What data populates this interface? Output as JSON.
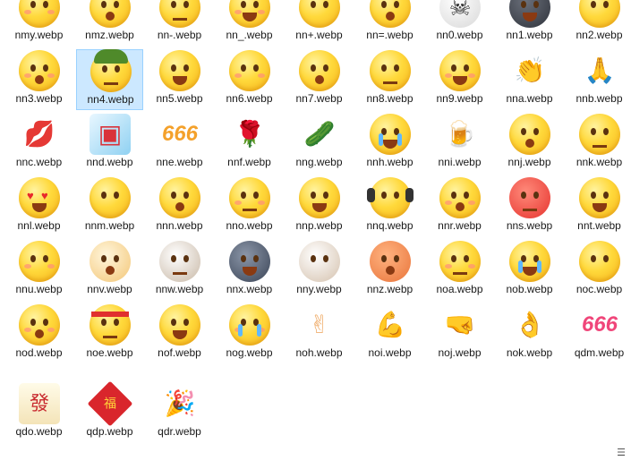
{
  "files": [
    {
      "name": "nmy.webp",
      "icon": "face-mask-emoji-icon"
    },
    {
      "name": "nmz.webp",
      "icon": "smirk-emoji-icon"
    },
    {
      "name": "nn-.webp",
      "icon": "surprised-emoji-icon"
    },
    {
      "name": "nn_.webp",
      "icon": "wink-tongue-emoji-icon"
    },
    {
      "name": "nn+.webp",
      "icon": "kiss-emoji-icon"
    },
    {
      "name": "nn=.webp",
      "icon": "grin-emoji-icon"
    },
    {
      "name": "nn0.webp",
      "icon": "skull-icon"
    },
    {
      "name": "nn1.webp",
      "icon": "dark-face-emoji-icon"
    },
    {
      "name": "nn2.webp",
      "icon": "watermelon-emoji-icon"
    },
    {
      "name": "nn3.webp",
      "icon": "big-grin-emoji-icon"
    },
    {
      "name": "nn4.webp",
      "icon": "green-hat-emoji-icon"
    },
    {
      "name": "nn5.webp",
      "icon": "sweat-emoji-icon"
    },
    {
      "name": "nn6.webp",
      "icon": "shy-emoji-icon"
    },
    {
      "name": "nn7.webp",
      "icon": "smile-emoji-icon"
    },
    {
      "name": "nn8.webp",
      "icon": "sweat-glance-emoji-icon"
    },
    {
      "name": "nn9.webp",
      "icon": "blush-emoji-icon"
    },
    {
      "name": "nna.webp",
      "icon": "clapping-hands-icon"
    },
    {
      "name": "nnb.webp",
      "icon": "praying-hands-icon"
    },
    {
      "name": "nnc.webp",
      "icon": "lips-icon"
    },
    {
      "name": "nnd.webp",
      "icon": "milk-box-icon"
    },
    {
      "name": "nne.webp",
      "icon": "666-orange-icon"
    },
    {
      "name": "nnf.webp",
      "icon": "rose-icon"
    },
    {
      "name": "nng.webp",
      "icon": "cucumber-icon"
    },
    {
      "name": "nnh.webp",
      "icon": "crying-emoji-icon"
    },
    {
      "name": "nni.webp",
      "icon": "beer-mug-icon"
    },
    {
      "name": "nnj.webp",
      "icon": "facepalm-emoji-icon"
    },
    {
      "name": "nnk.webp",
      "icon": "peek-emoji-icon"
    },
    {
      "name": "nnl.webp",
      "icon": "heart-eyes-emoji-icon"
    },
    {
      "name": "nnm.webp",
      "icon": "squint-emoji-icon"
    },
    {
      "name": "nnn.webp",
      "icon": "blowing-kiss-emoji-icon"
    },
    {
      "name": "nno.webp",
      "icon": "thinking-emoji-icon"
    },
    {
      "name": "nnp.webp",
      "icon": "gasp-emoji-icon"
    },
    {
      "name": "nnq.webp",
      "icon": "headphones-emoji-icon"
    },
    {
      "name": "nnr.webp",
      "icon": "small-shock-emoji-icon"
    },
    {
      "name": "nns.webp",
      "icon": "angry-red-emoji-icon"
    },
    {
      "name": "nnt.webp",
      "icon": "duck-lips-emoji-icon"
    },
    {
      "name": "nnu.webp",
      "icon": "buck-teeth-emoji-icon"
    },
    {
      "name": "nnv.webp",
      "icon": "shiba-dog-icon"
    },
    {
      "name": "nnw.webp",
      "icon": "cat-face-icon"
    },
    {
      "name": "nnx.webp",
      "icon": "husky-dog-icon"
    },
    {
      "name": "nny.webp",
      "icon": "dizzy-dog-icon"
    },
    {
      "name": "nnz.webp",
      "icon": "bear-face-icon"
    },
    {
      "name": "noa.webp",
      "icon": "sleepy-emoji-icon"
    },
    {
      "name": "nob.webp",
      "icon": "laugh-cry-emoji-icon"
    },
    {
      "name": "noc.webp",
      "icon": "starry-eyes-emoji-icon"
    },
    {
      "name": "nod.webp",
      "icon": "hammer-head-emoji-icon"
    },
    {
      "name": "noe.webp",
      "icon": "headband-emoji-icon"
    },
    {
      "name": "nof.webp",
      "icon": "rainbow-vomit-emoji-icon"
    },
    {
      "name": "nog.webp",
      "icon": "wailing-emoji-icon"
    },
    {
      "name": "noh.webp",
      "icon": "finger-heart-icon"
    },
    {
      "name": "noi.webp",
      "icon": "flexed-bicep-icon"
    },
    {
      "name": "noj.webp",
      "icon": "fist-salute-icon"
    },
    {
      "name": "nok.webp",
      "icon": "ok-hand-icon"
    },
    {
      "name": "qdm.webp",
      "icon": "666-pink-icon"
    },
    {
      "name": "qdo.webp",
      "icon": "mahjong-tile-icon"
    },
    {
      "name": "qdp.webp",
      "icon": "fu-blessing-icon"
    },
    {
      "name": "qdr.webp",
      "icon": "party-popper-icon"
    }
  ],
  "selected_index": 10,
  "colors": {
    "selection": "#cce8ff",
    "selection_border": "#99d1ff",
    "face_yellow": "#ffd93b"
  }
}
